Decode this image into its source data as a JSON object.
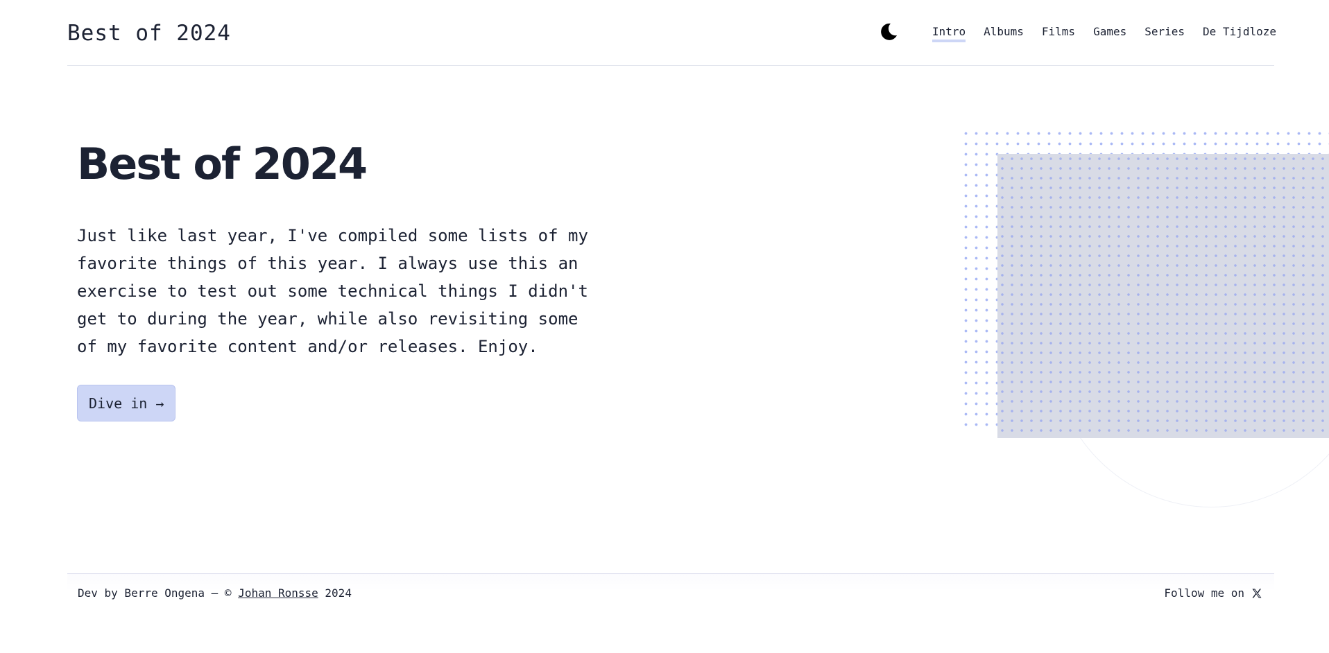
{
  "header": {
    "title": "Best of 2024",
    "theme_toggle_icon": "moon-icon",
    "nav": [
      {
        "label": "Intro",
        "active": true
      },
      {
        "label": "Albums",
        "active": false
      },
      {
        "label": "Films",
        "active": false
      },
      {
        "label": "Games",
        "active": false
      },
      {
        "label": "Series",
        "active": false
      },
      {
        "label": "De Tijdloze",
        "active": false
      }
    ]
  },
  "hero": {
    "title": "Best of 2024",
    "intro": "Just like last year, I've compiled some lists of my favorite things of this year. I always use this an exercise to test out some technical things I didn't get to during the year, while also revisiting some of my favorite content and/or releases. Enjoy.",
    "cta_label": "Dive in →"
  },
  "footer": {
    "credit_prefix": "Dev by Berre Ongena — © ",
    "credit_link": "Johan Ronsse",
    "credit_suffix": " 2024",
    "follow_label": "Follow me on",
    "follow_icon": "x-logo-icon"
  },
  "colors": {
    "text": "#1c2233",
    "accent": "#cdd6f6",
    "dots": "#a9b8f5",
    "block": "#d8dbe6"
  }
}
